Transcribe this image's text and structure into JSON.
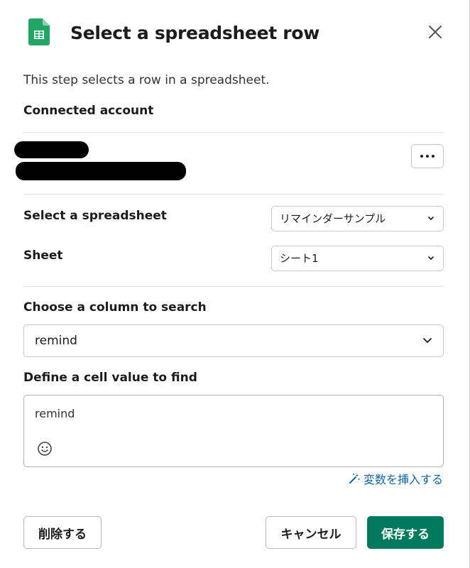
{
  "header": {
    "title": "Select a spreadsheet row",
    "app_icon": "google-sheets-icon",
    "close_icon": "close-icon"
  },
  "description": "This step selects a row in a spreadsheet.",
  "connected_account": {
    "label": "Connected account",
    "more_icon": "more-horizontal-icon"
  },
  "spreadsheet": {
    "label": "Select a spreadsheet",
    "value": "リマインダーサンプル"
  },
  "sheet": {
    "label": "Sheet",
    "value": "シート1"
  },
  "column": {
    "label": "Choose a column to search",
    "value": "remind"
  },
  "cell_value": {
    "label": "Define a cell value to find",
    "value": "remind",
    "emoji_icon": "emoji-icon"
  },
  "insert_variable": {
    "label": "変数を挿入する",
    "icon": "magic-wand-icon"
  },
  "buttons": {
    "delete": "削除する",
    "cancel": "キャンセル",
    "save": "保存する"
  },
  "colors": {
    "primary": "#007a5a",
    "link": "#1264a3",
    "sheets_green": "#23a566"
  }
}
